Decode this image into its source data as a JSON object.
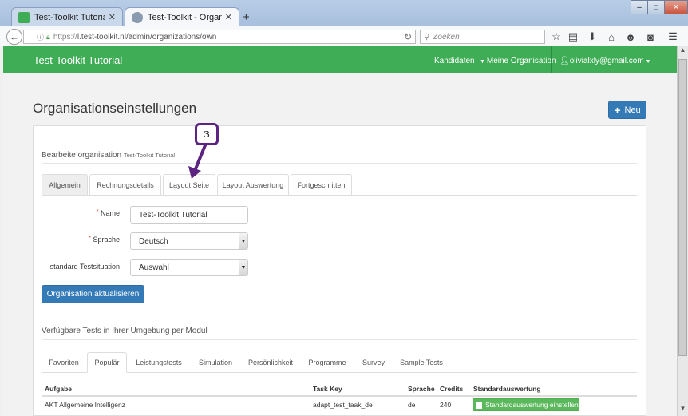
{
  "browser": {
    "tabs": [
      {
        "title": "Test-Toolkit Tutorial > Ixly",
        "favicon_color": "#3ead55"
      },
      {
        "title": "Test-Toolkit - Organisation…",
        "favicon_color": "#8a9bb0"
      }
    ],
    "new_tab_symbol": "+",
    "window_controls": {
      "minimize": "–",
      "maximize": "□",
      "close": "✕"
    },
    "url_scheme": "https://",
    "url_rest": "l.test-toolkit.nl/admin/organizations/own",
    "search_placeholder": "Zoeken"
  },
  "app": {
    "brand": "Test-Toolkit Tutorial",
    "nav": {
      "kandidaten": "Kandidaten",
      "organisation": "Meine Organisation",
      "user": "olivialxly@gmail.com"
    },
    "page_title": "Organisationseinstellungen",
    "new_button": "Neu",
    "edit_heading": "Bearbeite organisation",
    "edit_org_name": "Test-Toolkit Tutorial",
    "tabs": [
      "Allgemein",
      "Rechnungsdetails",
      "Layout Seite",
      "Layout Auswertung",
      "Fortgeschritten"
    ],
    "form": {
      "name_label": "Name",
      "name_value": "Test-Toolkit Tutorial",
      "language_label": "Sprache",
      "language_value": "Deutsch",
      "situation_label": "standard Testsituation",
      "situation_value": "Auswahl",
      "required_mark": "*"
    },
    "update_button": "Organisation aktualisieren",
    "tests_heading": "Verfügbare Tests in Ihrer Umgebung per Modul",
    "module_tabs": [
      "Favoriten",
      "Populär",
      "Leistungstests",
      "Simulation",
      "Persönlichkeit",
      "Programme",
      "Survey",
      "Sample Tests"
    ],
    "table": {
      "headers": [
        "Aufgabe",
        "Task Key",
        "Sprache",
        "Credits",
        "Standardauswertung"
      ],
      "rows": [
        {
          "aufgabe": "AKT Allgemeine Intelligenz",
          "task_key": "adapt_test_taak_de",
          "sprache": "de",
          "credits": "240",
          "action": "Standardauswertung einstellen"
        }
      ]
    }
  },
  "annotation": {
    "step_number": "3"
  },
  "colors": {
    "brand_green": "#3ead55",
    "primary_blue": "#337ab7",
    "success_green": "#5cb85c",
    "callout_purple": "#5c2480"
  }
}
